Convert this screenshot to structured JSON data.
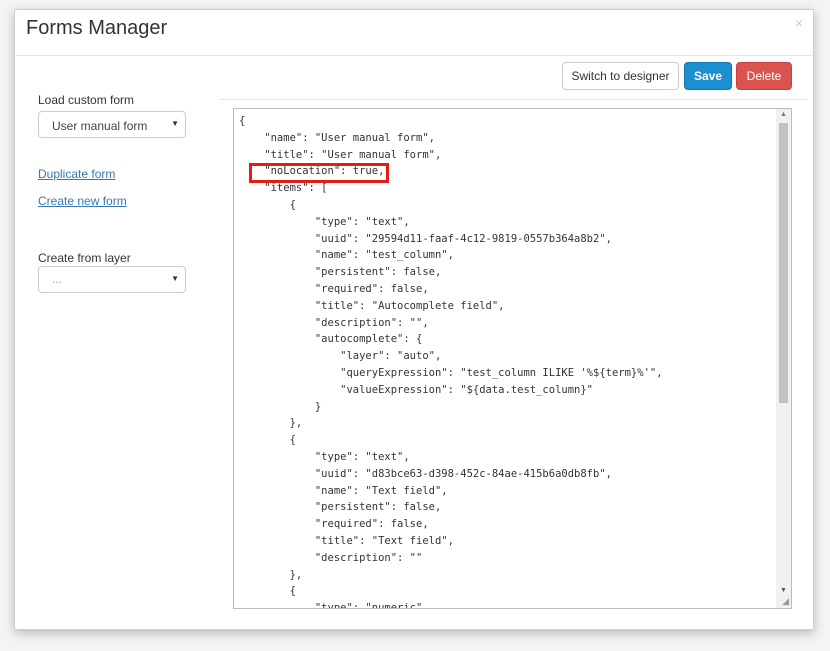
{
  "dialog": {
    "title": "Forms Manager",
    "close_glyph": "×"
  },
  "sidebar": {
    "load_label": "Load custom form",
    "load_selected": "User manual form",
    "duplicate_link": "Duplicate form",
    "create_link": "Create new form",
    "layer_label": "Create from layer",
    "layer_selected": "..."
  },
  "toolbar": {
    "designer_label": "Switch to designer",
    "save_label": "Save",
    "delete_label": "Delete"
  },
  "colors": {
    "save": "#1a8fd1",
    "delete": "#d9534f",
    "link": "#337ab7",
    "highlight": "#e41b17"
  },
  "editor": {
    "highlighted_line": "\"noLocation\": true,",
    "lines": [
      "{",
      "    \"name\": \"User manual form\",",
      "    \"title\": \"User manual form\",",
      "    \"noLocation\": true,",
      "    \"items\": [",
      "        {",
      "            \"type\": \"text\",",
      "            \"uuid\": \"29594d11-faaf-4c12-9819-0557b364a8b2\",",
      "            \"name\": \"test_column\",",
      "            \"persistent\": false,",
      "            \"required\": false,",
      "            \"title\": \"Autocomplete field\",",
      "            \"description\": \"\",",
      "            \"autocomplete\": {",
      "                \"layer\": \"auto\",",
      "                \"queryExpression\": \"test_column ILIKE '%${term}%'\",",
      "                \"valueExpression\": \"${data.test_column}\"",
      "            }",
      "        },",
      "        {",
      "            \"type\": \"text\",",
      "            \"uuid\": \"d83bce63-d398-452c-84ae-415b6a0db8fb\",",
      "            \"name\": \"Text field\",",
      "            \"persistent\": false,",
      "            \"required\": false,",
      "            \"title\": \"Text field\",",
      "            \"description\": \"\"",
      "        },",
      "        {",
      "            \"type\": \"numeric\","
    ]
  }
}
